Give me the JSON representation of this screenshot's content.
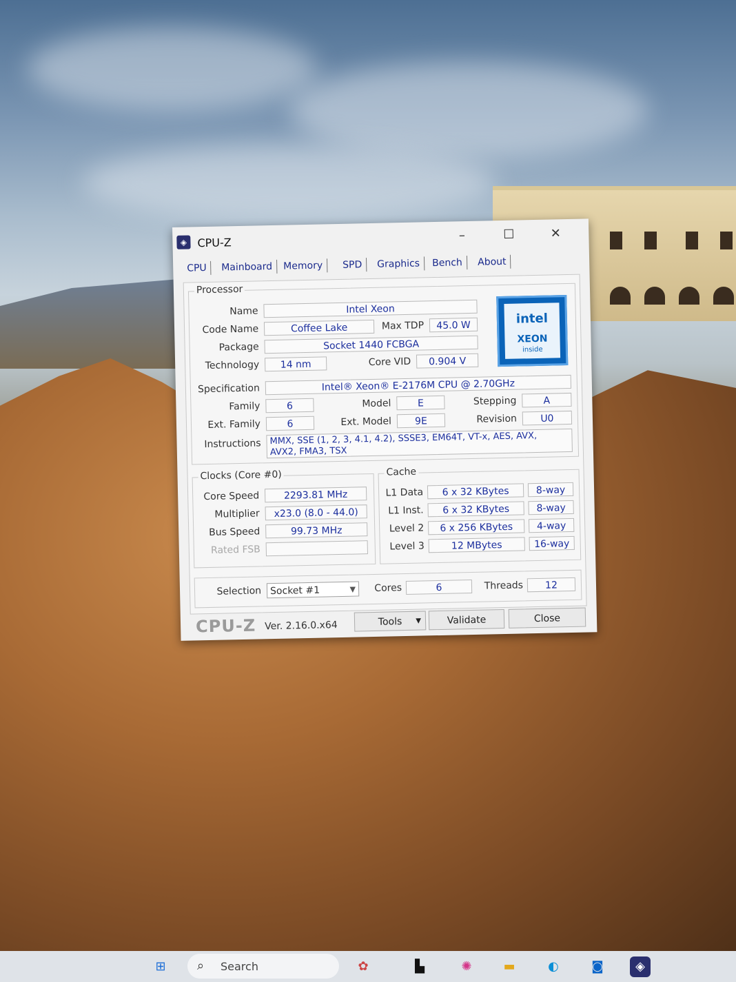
{
  "window": {
    "title": "CPU-Z"
  },
  "tabs": [
    "CPU",
    "Mainboard",
    "Memory",
    "SPD",
    "Graphics",
    "Bench",
    "About"
  ],
  "processor": {
    "group_label": "Processor",
    "name_label": "Name",
    "name": "Intel Xeon",
    "code_name_label": "Code Name",
    "code_name": "Coffee Lake",
    "max_tdp_label": "Max TDP",
    "max_tdp": "45.0 W",
    "package_label": "Package",
    "package": "Socket 1440 FCBGA",
    "technology_label": "Technology",
    "technology": "14 nm",
    "core_vid_label": "Core VID",
    "core_vid": "0.904 V",
    "specification_label": "Specification",
    "specification": "Intel® Xeon® E-2176M  CPU @ 2.70GHz",
    "family_label": "Family",
    "family": "6",
    "model_label": "Model",
    "model": "E",
    "stepping_label": "Stepping",
    "stepping": "A",
    "ext_family_label": "Ext. Family",
    "ext_family": "6",
    "ext_model_label": "Ext. Model",
    "ext_model": "9E",
    "revision_label": "Revision",
    "revision": "U0",
    "instructions_label": "Instructions",
    "instructions_line1": "MMX, SSE (1, 2, 3, 4.1, 4.2), SSSE3, EM64T, VT-x, AES, AVX,",
    "instructions_line2": "AVX2, FMA3, TSX"
  },
  "badge": {
    "brand": "intel",
    "line": "XEON",
    "sub": "inside"
  },
  "clocks": {
    "group_label": "Clocks (Core #0)",
    "core_speed_label": "Core Speed",
    "core_speed": "2293.81 MHz",
    "multiplier_label": "Multiplier",
    "multiplier": "x23.0 (8.0 - 44.0)",
    "bus_speed_label": "Bus Speed",
    "bus_speed": "99.73 MHz",
    "rated_fsb_label": "Rated FSB",
    "rated_fsb": ""
  },
  "cache": {
    "group_label": "Cache",
    "l1_data_label": "L1 Data",
    "l1_data": "6 x 32 KBytes",
    "l1_data_way": "8-way",
    "l1_inst_label": "L1 Inst.",
    "l1_inst": "6 x 32 KBytes",
    "l1_inst_way": "8-way",
    "level2_label": "Level 2",
    "level2": "6 x 256 KBytes",
    "level2_way": "4-way",
    "level3_label": "Level 3",
    "level3": "12 MBytes",
    "level3_way": "16-way"
  },
  "selection": {
    "selection_label": "Selection",
    "socket": "Socket #1",
    "cores_label": "Cores",
    "cores": "6",
    "threads_label": "Threads",
    "threads": "12"
  },
  "footer": {
    "logo": "CPU-Z",
    "version": "Ver. 2.16.0.x64",
    "tools": "Tools",
    "validate": "Validate",
    "close": "Close"
  },
  "taskbar": {
    "search_placeholder": "Search"
  }
}
